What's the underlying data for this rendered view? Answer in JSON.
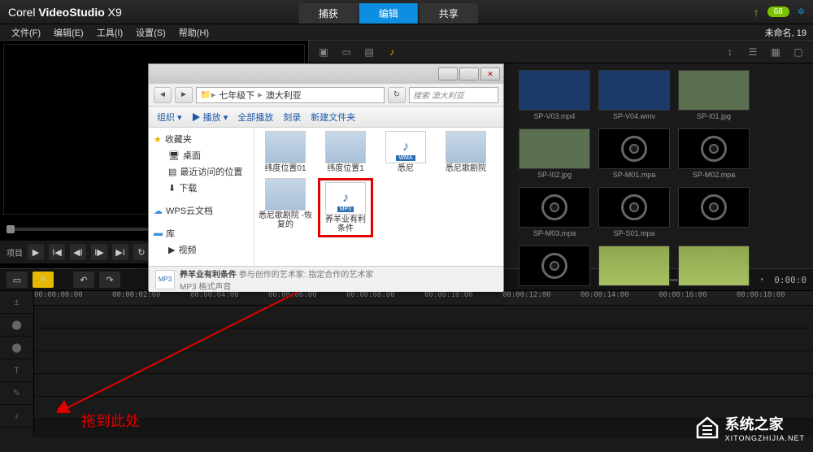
{
  "app": {
    "brand_prefix": "Corel",
    "brand_main": "VideoStudio",
    "brand_suffix": "X9"
  },
  "top_tabs": {
    "capture": "捕获",
    "edit": "编辑",
    "share": "共享"
  },
  "progress_value": "68",
  "menu": {
    "file": "文件(F)",
    "edit": "编辑(E)",
    "tools": "工具(I)",
    "settings": "设置(S)",
    "help": "帮助(H)"
  },
  "file_name_label": "未命名, 19",
  "player": {
    "project": "项目"
  },
  "thumbs": [
    {
      "label": "SP-V03.mp4",
      "kind": "blue"
    },
    {
      "label": "SP-V04.wmv",
      "kind": "blue"
    },
    {
      "label": "SP-I01.jpg",
      "kind": "photo"
    },
    {
      "label": "SP-I02.jpg",
      "kind": "photo"
    },
    {
      "label": "SP-M01.mpa",
      "kind": "cd"
    },
    {
      "label": "SP-M02.mpa",
      "kind": "cd"
    },
    {
      "label": "SP-M03.mpa",
      "kind": "cd"
    },
    {
      "label": "SP-S01.mpa",
      "kind": "cd"
    },
    {
      "label": "",
      "kind": "cd"
    },
    {
      "label": "",
      "kind": "cd"
    },
    {
      "label": "",
      "kind": "green"
    },
    {
      "label": "",
      "kind": "green"
    }
  ],
  "timeline": {
    "ticks": [
      "00:00:00:00",
      "00:00:02:00",
      "00:00:04:00",
      "00:00:06:00",
      "00:00:08:00",
      "00:00:10:00",
      "00:00:12:00",
      "00:00:14:00",
      "00:00:16:00",
      "00:00:18:00"
    ],
    "timecode": "0:00:0"
  },
  "explorer": {
    "breadcrumb": [
      "七年级下",
      "澳大利亚"
    ],
    "search_placeholder": "搜索 澳大利亚",
    "toolbar": {
      "organize": "组织 ▾",
      "play": "▶ 播放 ▾",
      "play_all": "全部播放",
      "burn": "刻录",
      "new_folder": "新建文件夹"
    },
    "sidebar": {
      "favorites": "收藏夹",
      "items": [
        "桌面",
        "最近访问的位置",
        "下载"
      ],
      "cloud": "WPS云文档",
      "library": "库",
      "video": "视频"
    },
    "files": [
      {
        "caption": "纬度位置01",
        "type": "img"
      },
      {
        "caption": "纬度位置1",
        "type": "img"
      },
      {
        "caption": "悉尼",
        "type": "wma",
        "tag": "WMA"
      },
      {
        "caption": "悉尼歌剧院",
        "type": "img"
      },
      {
        "caption": "悉尼歌剧院\n-恢复的",
        "type": "img"
      },
      {
        "caption": "养羊业有利\n条件",
        "type": "mp3",
        "tag": "MP3",
        "highlight": true
      }
    ],
    "status": {
      "title": "养羊业有利条件",
      "artists": "参与创作的艺术家: 指定合作的艺术家",
      "format": "MP3 格式声音",
      "tag": "MP3"
    }
  },
  "annotation": {
    "drag_here": "拖到此处"
  },
  "watermark": {
    "cn": "系统之家",
    "url": "XITONGZHIJIA.NET"
  }
}
